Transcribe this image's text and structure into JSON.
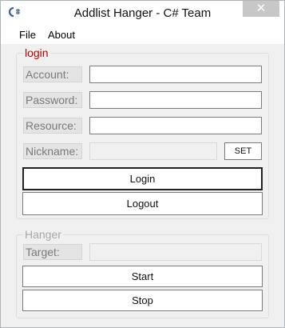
{
  "window": {
    "title": "Addlist Hanger - C# Team",
    "close_glyph": "✕",
    "app_icon": "csharp-app-icon"
  },
  "menu": {
    "items": [
      "File",
      "About"
    ]
  },
  "login_group": {
    "title": "login",
    "account_label": "Account:",
    "account_value": "",
    "password_label": "Password:",
    "password_value": "",
    "resource_label": "Resource:",
    "resource_value": "",
    "nickname_label": "Nickname:",
    "nickname_value": "",
    "set_button": "SET",
    "login_button": "Login",
    "logout_button": "Logout"
  },
  "hanger_group": {
    "title": "Hanger",
    "target_label": "Target:",
    "target_value": "",
    "start_button": "Start",
    "stop_button": "Stop"
  },
  "colors": {
    "login_title": "#c00000",
    "hanger_title": "#a9a9a9",
    "close_button": "#c7c7c7"
  }
}
